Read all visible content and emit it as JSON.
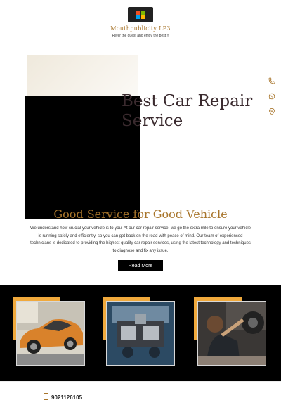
{
  "header": {
    "brand": "Mouthpublicity LP3",
    "tagline": "Refer the guest and enjoy the best!!!"
  },
  "hero": {
    "title_line1": "Best Car Repair",
    "title_line2": "Service"
  },
  "side_icons": [
    "phone-icon",
    "whatsapp-icon",
    "location-pin-icon"
  ],
  "about": {
    "title": "Good Service for Good Vehicle",
    "body": "We understand how crucial your vehicle is to you. At our car repair service, we go the extra mile to ensure your vehicle is running safely and efficiently, so you can get back on the road with peace of mind. Our team of experienced technicians is dedicated to providing the highest quality car repair services, using the latest technology and techniques to diagnose and fix any issue.",
    "button_label": "Read More"
  },
  "gallery": {
    "images": [
      "orange-classic-car-photo",
      "engine-bay-photo",
      "mechanic-under-car-photo"
    ],
    "accent_color": "#f0a93c"
  },
  "footer": {
    "phone": "9021126105"
  },
  "colors": {
    "brand": "#a8752b",
    "title": "#3a2a2e",
    "dark": "#000000"
  }
}
